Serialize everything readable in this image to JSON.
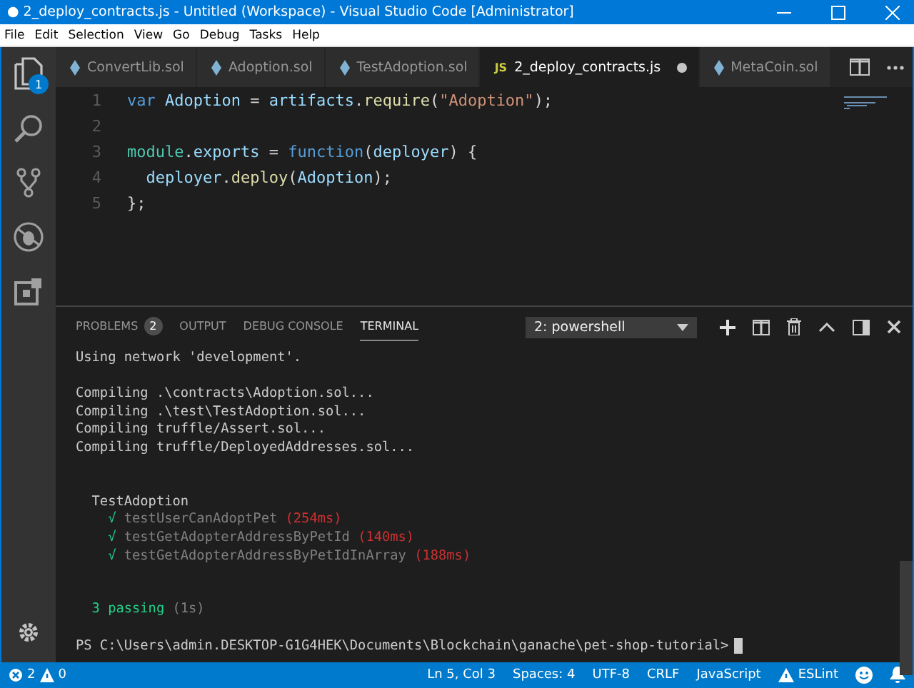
{
  "window": {
    "title": "● 2_deploy_contracts.js - Untitled (Workspace) - Visual Studio Code [Administrator]"
  },
  "menu": [
    "File",
    "Edit",
    "Selection",
    "View",
    "Go",
    "Debug",
    "Tasks",
    "Help"
  ],
  "activity_bar": {
    "explorer_badge": "1"
  },
  "tabs": [
    {
      "label": "ConvertLib.sol",
      "kind": "sol",
      "selected": false,
      "modified": false
    },
    {
      "label": "Adoption.sol",
      "kind": "sol",
      "selected": false,
      "modified": false
    },
    {
      "label": "TestAdoption.sol",
      "kind": "sol",
      "selected": false,
      "modified": false
    },
    {
      "label": "2_deploy_contracts.js",
      "kind": "js",
      "selected": true,
      "modified": true
    },
    {
      "label": "MetaCoin.sol",
      "kind": "sol",
      "selected": false,
      "modified": false
    }
  ],
  "js_badge": "JS",
  "editor": {
    "lines": [
      {
        "number": "1",
        "tokens": [
          {
            "text": "var ",
            "kind": "keyword"
          },
          {
            "text": "Adoption",
            "kind": "var"
          },
          {
            "text": " = ",
            "kind": "plain"
          },
          {
            "text": "artifacts",
            "kind": "var"
          },
          {
            "text": ".",
            "kind": "plain"
          },
          {
            "text": "require",
            "kind": "func"
          },
          {
            "text": "(",
            "kind": "plain"
          },
          {
            "text": "\"Adoption\"",
            "kind": "string"
          },
          {
            "text": ");",
            "kind": "plain"
          }
        ]
      },
      {
        "number": "2"
      },
      {
        "number": "3",
        "tokens": [
          {
            "text": "module",
            "kind": "type"
          },
          {
            "text": ".",
            "kind": "plain"
          },
          {
            "text": "exports",
            "kind": "var"
          },
          {
            "text": " = ",
            "kind": "plain"
          },
          {
            "text": "function",
            "kind": "keyword"
          },
          {
            "text": "(",
            "kind": "plain"
          },
          {
            "text": "deployer",
            "kind": "var"
          },
          {
            "text": ") {",
            "kind": "plain"
          }
        ]
      },
      {
        "number": "4",
        "tokens": [
          {
            "text": "  deployer",
            "kind": "var"
          },
          {
            "text": ".",
            "kind": "plain"
          },
          {
            "text": "deploy",
            "kind": "func"
          },
          {
            "text": "(",
            "kind": "plain"
          },
          {
            "text": "Adoption",
            "kind": "var"
          },
          {
            "text": ");",
            "kind": "plain"
          }
        ]
      },
      {
        "number": "5",
        "tokens": [
          {
            "text": "};",
            "kind": "plain"
          }
        ]
      }
    ]
  },
  "panel": {
    "tabs": [
      {
        "label": "PROBLEMS",
        "badge": "2",
        "selected": false
      },
      {
        "label": "OUTPUT",
        "selected": false
      },
      {
        "label": "DEBUG CONSOLE",
        "selected": false
      },
      {
        "label": "TERMINAL",
        "selected": true
      }
    ],
    "terminal_select": "2: powershell",
    "blocks": [
      {
        "kind": "log",
        "lines": [
          {
            "parts": [
              {
                "text": "Using network 'development'.",
                "kind": "plain"
              }
            ]
          }
        ]
      },
      {
        "kind": "compile",
        "lines": [
          {
            "parts": [
              {
                "text": "Compiling .\\contracts\\Adoption.sol...",
                "kind": "plain"
              }
            ]
          },
          {
            "parts": [
              {
                "text": "Compiling .\\test\\TestAdoption.sol...",
                "kind": "plain"
              }
            ]
          },
          {
            "parts": [
              {
                "text": "Compiling truffle/Assert.sol...",
                "kind": "plain"
              }
            ]
          },
          {
            "parts": [
              {
                "text": "Compiling truffle/DeployedAddresses.sol...",
                "kind": "plain"
              }
            ]
          }
        ]
      },
      {
        "kind": "suite",
        "lines": [
          {
            "parts": [
              {
                "text": "  TestAdoption",
                "kind": "plain"
              }
            ]
          },
          {
            "parts": [
              {
                "text": "    √ ",
                "kind": "pass"
              },
              {
                "text": "testUserCanAdoptPet ",
                "kind": "dim"
              },
              {
                "text": "(254ms)",
                "kind": "slow"
              }
            ]
          },
          {
            "parts": [
              {
                "text": "    √ ",
                "kind": "pass"
              },
              {
                "text": "testGetAdopterAddressByPetId ",
                "kind": "dim"
              },
              {
                "text": "(140ms)",
                "kind": "slow"
              }
            ]
          },
          {
            "parts": [
              {
                "text": "    √ ",
                "kind": "pass"
              },
              {
                "text": "testGetAdopterAddressByPetIdInArray ",
                "kind": "dim"
              },
              {
                "text": "(188ms)",
                "kind": "slow"
              }
            ]
          }
        ]
      },
      {
        "kind": "summary",
        "lines": [
          {
            "parts": [
              {
                "text": "  3 passing ",
                "kind": "pass"
              },
              {
                "text": "(1s)",
                "kind": "dim"
              }
            ]
          }
        ]
      },
      {
        "kind": "prompt",
        "lines": [
          {
            "parts": [
              {
                "text": "PS C:\\Users\\admin.DESKTOP-G1G4HEK\\Documents\\Blockchain\\ganache\\pet-shop-tutorial>",
                "kind": "plain"
              }
            ],
            "cursor": true
          }
        ]
      }
    ]
  },
  "status_bar": {
    "errors": "2",
    "warnings": "0",
    "items": [
      "Ln 5, Col 3",
      "Spaces: 4",
      "UTF-8",
      "CRLF",
      "JavaScript"
    ],
    "eslint": "ESLint"
  }
}
